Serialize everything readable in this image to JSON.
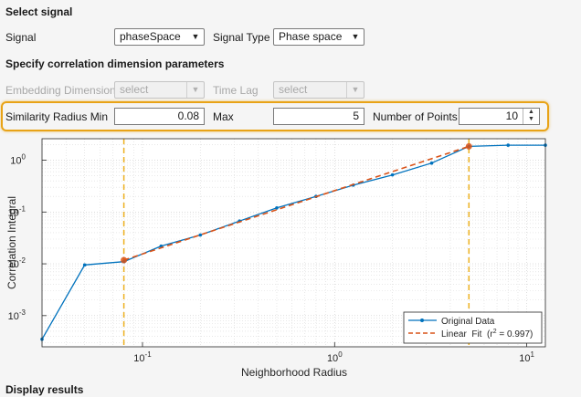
{
  "sections": {
    "select_signal": "Select signal",
    "correlation_params": "Specify correlation dimension parameters",
    "display_results": "Display results"
  },
  "signal": {
    "label": "Signal",
    "value": "phaseSpace"
  },
  "signal_type": {
    "label": "Signal Type",
    "value": "Phase space"
  },
  "embedding": {
    "label": "Embedding Dimension",
    "value": "select"
  },
  "time_lag": {
    "label": "Time Lag",
    "value": "select"
  },
  "radius_min": {
    "label": "Similarity Radius Min",
    "value": "0.08"
  },
  "radius_max": {
    "label": "Max",
    "value": "5"
  },
  "num_points": {
    "label": "Number of Points",
    "value": "10"
  },
  "colors": {
    "original": "#0072bd",
    "fit": "#d95319",
    "bounds": "#edb120",
    "highlight": "#e8a317"
  },
  "chart_data": {
    "type": "line",
    "xlabel": "Neighborhood Radius",
    "ylabel": "Correlation Integral",
    "x_scale": "log",
    "y_scale": "log",
    "xlim": [
      0.03,
      12.5
    ],
    "ylim": [
      0.00025,
      2.6
    ],
    "x_ticks": [
      {
        "v": 0.1,
        "base": "10",
        "exp": "-1"
      },
      {
        "v": 1,
        "base": "10",
        "exp": "0"
      },
      {
        "v": 10,
        "base": "10",
        "exp": "1"
      }
    ],
    "y_ticks": [
      {
        "v": 0.001,
        "base": "10",
        "exp": "-3"
      },
      {
        "v": 0.01,
        "base": "10",
        "exp": "-2"
      },
      {
        "v": 0.1,
        "base": "10",
        "exp": "-1"
      },
      {
        "v": 1,
        "base": "10",
        "exp": "0"
      }
    ],
    "grid": true,
    "series": [
      {
        "name": "Original Data",
        "x": [
          0.03,
          0.05,
          0.08,
          0.125,
          0.2,
          0.32,
          0.5,
          0.8,
          1.25,
          2,
          3.2,
          5,
          8,
          12.5
        ],
        "y": [
          0.00035,
          0.0095,
          0.011,
          0.022,
          0.036,
          0.067,
          0.12,
          0.2,
          0.33,
          0.52,
          0.88,
          1.85,
          1.95,
          1.95
        ]
      },
      {
        "name_prefix": "Linear  Fit  (r",
        "name_sup": "2",
        "name_suffix": " = 0.997)",
        "x": [
          0.08,
          5
        ],
        "y": [
          0.0118,
          1.85
        ]
      }
    ],
    "bounds_x": [
      0.08,
      5
    ],
    "legend_position": "bottom-right"
  }
}
